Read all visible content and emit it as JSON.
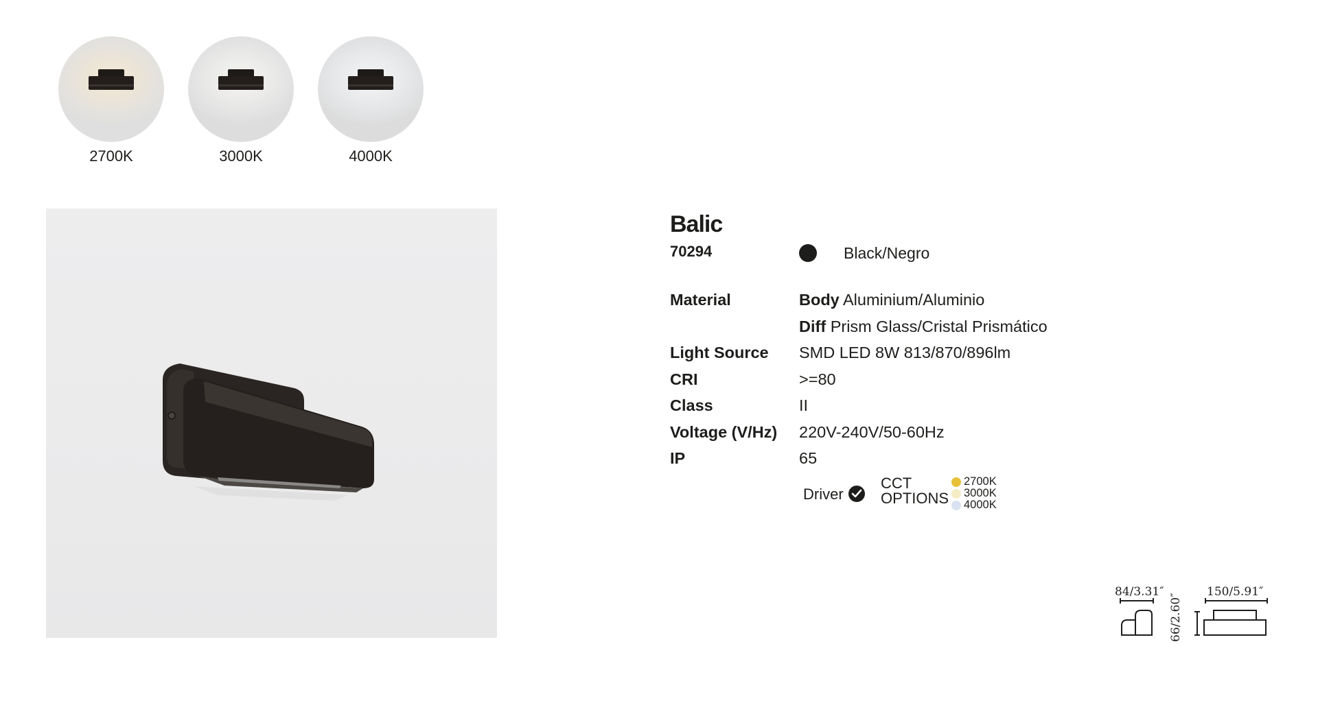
{
  "cct_swatches": [
    {
      "label": "2700K",
      "tone": "warm"
    },
    {
      "label": "3000K",
      "tone": "neutral"
    },
    {
      "label": "4000K",
      "tone": "cool"
    }
  ],
  "product": {
    "name": "Balic",
    "code": "70294",
    "color_name": "Black/Negro",
    "color_hex": "#1d1d1b"
  },
  "specs": {
    "material_label": "Material",
    "body_label": "Body",
    "body_value": "Aluminium/Aluminio",
    "diff_label": "Diff",
    "diff_value": "Prism Glass/Cristal Prismático",
    "light_source_label": "Light Source",
    "light_source_value": "SMD LED 8W  813/870/896lm",
    "cri_label": "CRI",
    "cri_value": ">=80",
    "class_label": "Class",
    "class_value": "II",
    "voltage_label": "Voltage (V/Hz)",
    "voltage_value": "220V-240V/50-60Hz",
    "ip_label": "IP",
    "ip_value": "65"
  },
  "driver": {
    "label": "Driver",
    "cct_label_line1": "CCT",
    "cct_label_line2": "OPTIONS",
    "options": [
      {
        "label": "2700K",
        "color": "#e8c13a"
      },
      {
        "label": "3000K",
        "color": "#f6edc6"
      },
      {
        "label": "4000K",
        "color": "#d9e2f0"
      }
    ]
  },
  "dimensions": {
    "depth": "84/3.31″",
    "height": "66/2.60″",
    "width": "150/5.91″"
  }
}
